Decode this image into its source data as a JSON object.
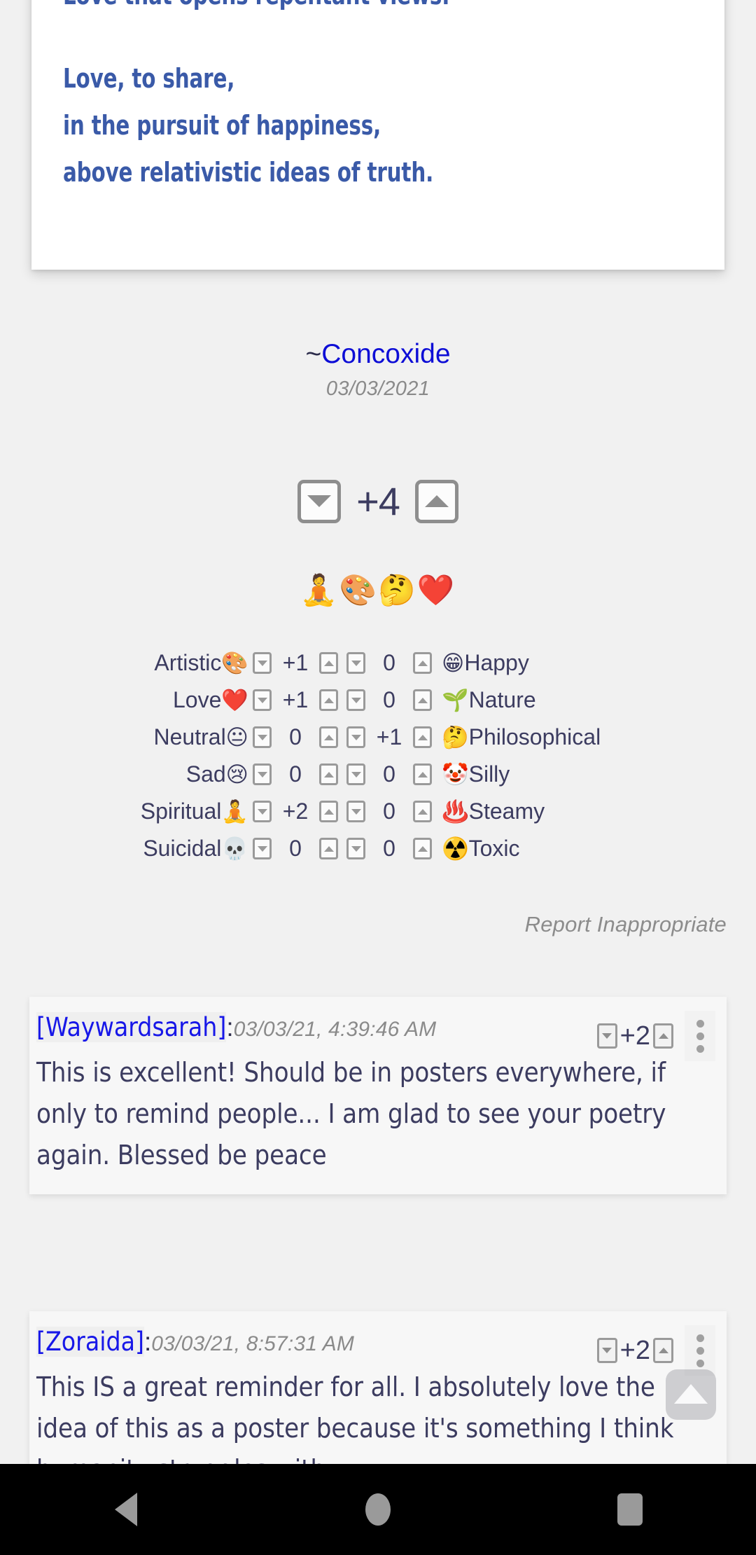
{
  "poem": {
    "lines": [
      "Love that opens repentant views.",
      "",
      "Love, to share,",
      "in the pursuit of happiness,",
      "above relativistic ideas of truth."
    ]
  },
  "author": {
    "tilde": "~",
    "name": "Concoxide",
    "date": "03/03/2021"
  },
  "main_vote": {
    "score": "+4",
    "downvote_label": "downvote",
    "upvote_label": "upvote"
  },
  "emoji_summary": "🧘🎨🤔❤️",
  "reactions": [
    {
      "left_label": "Artistic",
      "left_emoji": "🎨",
      "left_count": "+1",
      "right_count": "0",
      "right_emoji": "😁",
      "right_label": "Happy"
    },
    {
      "left_label": "Love",
      "left_emoji": "❤️",
      "left_count": "+1",
      "right_count": "0",
      "right_emoji": "🌱",
      "right_label": "Nature"
    },
    {
      "left_label": "Neutral",
      "left_emoji": "😐",
      "left_count": "0",
      "right_count": "+1",
      "right_emoji": "🤔",
      "right_label": "Philosophical"
    },
    {
      "left_label": "Sad",
      "left_emoji": "😢",
      "left_count": "0",
      "right_count": "0",
      "right_emoji": "🤡",
      "right_label": "Silly"
    },
    {
      "left_label": "Spiritual",
      "left_emoji": "🧘",
      "left_count": "+2",
      "right_count": "0",
      "right_emoji": "♨️",
      "right_label": "Steamy"
    },
    {
      "left_label": "Suicidal",
      "left_emoji": "💀",
      "left_count": "0",
      "right_count": "0",
      "right_emoji": "☢️",
      "right_label": "Toxic"
    }
  ],
  "report": {
    "label": "Report Inappropriate"
  },
  "comments": [
    {
      "user": "[Waywardsarah]",
      "colon": ":",
      "time": "03/03/21, 4:39:46 AM",
      "score": "+2",
      "body": "This is excellent! Should be in posters everywhere, if only to remind people... I am glad to see your poetry again. Blessed be peace"
    },
    {
      "user": "[Zoraida]",
      "colon": ":",
      "time": "03/03/21, 8:57:31 AM",
      "score": "+2",
      "body": "This IS a great reminder for all. I absolutely love the idea of this as a poster because it's something I think humanity struggles with"
    }
  ],
  "fab": {
    "label": "scroll-to-top"
  },
  "navbar": {
    "back": "back",
    "home": "home",
    "recent": "recent-apps"
  },
  "colors": {
    "poem_text": "#3a5aa8",
    "link": "#1717e8",
    "body_text": "#3c3c60",
    "muted": "#8a8a8a",
    "page_bg": "#f1f1f1",
    "card_bg": "#ffffff"
  }
}
